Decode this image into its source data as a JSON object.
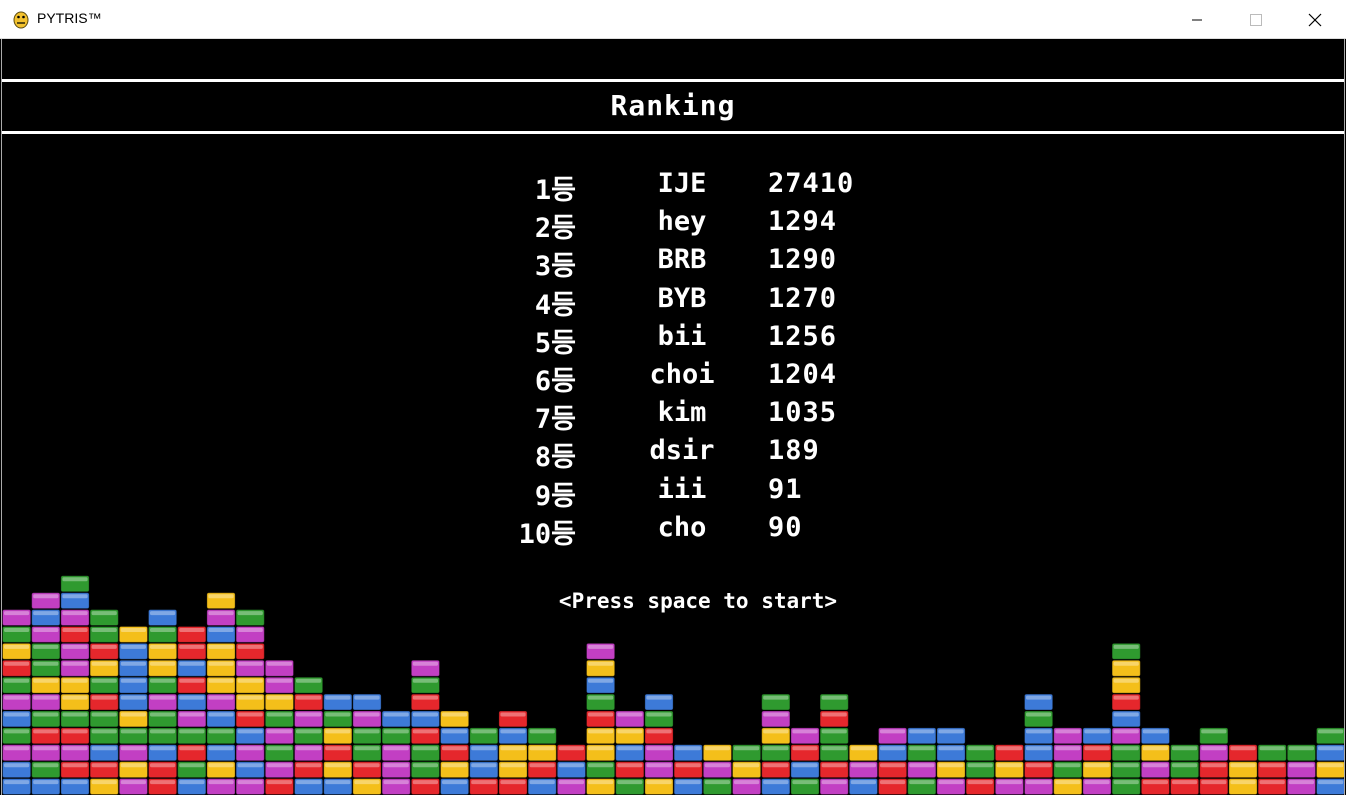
{
  "window": {
    "title": "PYTRIS™",
    "icons": [
      "python-icon",
      "minimize-icon",
      "maximize-icon",
      "close-icon"
    ]
  },
  "screen": {
    "heading": "Ranking",
    "prompt": "<Press space to start>",
    "rankings": [
      {
        "rank": "1등",
        "name": "IJE",
        "score": "27410"
      },
      {
        "rank": "2등",
        "name": "hey",
        "score": "1294"
      },
      {
        "rank": "3등",
        "name": "BRB",
        "score": "1290"
      },
      {
        "rank": "4등",
        "name": "BYB",
        "score": "1270"
      },
      {
        "rank": "5등",
        "name": "bii",
        "score": "1256"
      },
      {
        "rank": "6등",
        "name": "choi",
        "score": "1204"
      },
      {
        "rank": "7등",
        "name": "kim",
        "score": "1035"
      },
      {
        "rank": "8등",
        "name": "dsir",
        "score": "189"
      },
      {
        "rank": "9등",
        "name": "iii",
        "score": "91"
      },
      {
        "rank": "10등",
        "name": "cho",
        "score": "90"
      }
    ]
  },
  "block_colors": {
    "purple": "#c23fc3",
    "green": "#2f9a2f",
    "red": "#e5272c",
    "yellow": "#f4bf1a",
    "blue": "#3d7ad8"
  }
}
